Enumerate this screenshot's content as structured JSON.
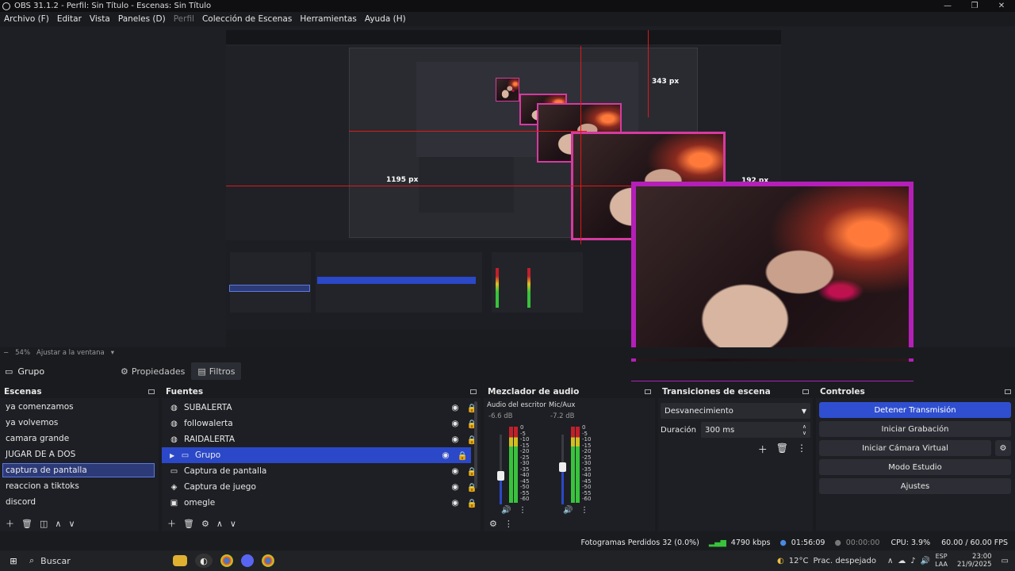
{
  "window": {
    "title": "OBS 31.1.2 - Perfil: Sin Título - Escenas: Sin Título"
  },
  "menu": [
    {
      "label": "Archivo (F)",
      "disabled": false
    },
    {
      "label": "Editar",
      "disabled": false
    },
    {
      "label": "Vista",
      "disabled": false
    },
    {
      "label": "Paneles (D)",
      "disabled": false
    },
    {
      "label": "Perfil",
      "disabled": true
    },
    {
      "label": "Colección de Escenas",
      "disabled": false
    },
    {
      "label": "Herramientas",
      "disabled": false
    },
    {
      "label": "Ayuda (H)",
      "disabled": false
    }
  ],
  "preview": {
    "labels": {
      "a": "343 px",
      "b": "1195 px",
      "c": "192 px"
    }
  },
  "zoombar": {
    "minus": "−",
    "zoom": "54%",
    "fit": "Ajustar a la ventana"
  },
  "context": {
    "group": "Grupo",
    "properties": "Propiedades",
    "filters": "Filtros"
  },
  "scenes": {
    "title": "Escenas",
    "items": [
      "ya comenzamos",
      "ya volvemos",
      "camara grande",
      "JUGAR DE A DOS",
      "captura de pantalla",
      "reaccion a tiktoks",
      "discord"
    ],
    "selected": 4
  },
  "sources": {
    "title": "Fuentes",
    "items": [
      {
        "label": "SUBALERTA",
        "icon": "globe-icon",
        "glyph": "◍",
        "expander": false
      },
      {
        "label": "followalerta",
        "icon": "globe-icon",
        "glyph": "◍",
        "expander": false
      },
      {
        "label": "RAIDALERTA",
        "icon": "globe-icon",
        "glyph": "◍",
        "expander": false
      },
      {
        "label": "Grupo",
        "icon": "folder-icon",
        "glyph": "▭",
        "expander": true
      },
      {
        "label": "Captura de pantalla",
        "icon": "monitor-icon",
        "glyph": "▭",
        "expander": false
      },
      {
        "label": "Captura de juego",
        "icon": "gamepad-icon",
        "glyph": "◈",
        "expander": false
      },
      {
        "label": "omegle",
        "icon": "window-icon",
        "glyph": "▣",
        "expander": false
      }
    ],
    "selected": 3
  },
  "mixer": {
    "title": "Mezclador de audio",
    "channels": [
      {
        "name": "Audio del escritorio",
        "db": "-6.6 dB",
        "level": 0.42
      },
      {
        "name": "Mic/Aux",
        "db": "-7.2 dB",
        "level": 0.55
      }
    ],
    "scale": [
      "0",
      "-5",
      "-10",
      "-15",
      "-20",
      "-25",
      "-30",
      "-35",
      "-40",
      "-45",
      "-50",
      "-55",
      "-60"
    ]
  },
  "transitions": {
    "title": "Transiciones de escena",
    "selected": "Desvanecimiento",
    "duration_label": "Duración",
    "duration_value": "300 ms"
  },
  "controls": {
    "title": "Controles",
    "buttons": [
      {
        "label": "Detener Transmisión",
        "primary": true
      },
      {
        "label": "Iniciar Grabación",
        "primary": false
      },
      {
        "label": "Iniciar Cámara Virtual",
        "primary": false
      },
      {
        "label": "Modo Estudio",
        "primary": false
      },
      {
        "label": "Ajustes",
        "primary": false
      }
    ]
  },
  "status": {
    "dropped": "Fotogramas Perdidos 32 (0.0%)",
    "bitrate": "4790 kbps",
    "stream_time": "01:56:09",
    "rec_time": "00:00:00",
    "cpu": "CPU: 3.9%",
    "fps": "60.00 / 60.00 FPS"
  },
  "taskbar": {
    "search": "Buscar",
    "weather_temp": "12°C",
    "weather_desc": "Prac. despejado",
    "lang1": "ESP",
    "lang2": "LAA",
    "time": "23:00",
    "date": "21/9/2025"
  },
  "colors": {
    "accent": "#2b48c8",
    "border_pink": "#d63aa0",
    "meter_green": "#39c23c",
    "meter_red": "#c0202a"
  }
}
